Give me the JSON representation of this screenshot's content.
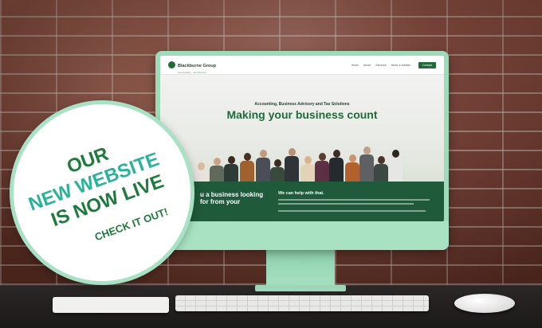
{
  "badge": {
    "line1": "OUR",
    "line2": "NEW WEBSITE",
    "line3": "IS NOW LIVE",
    "line4": "CHECK IT OUT!"
  },
  "website": {
    "logo_name": "Blackburne Group",
    "logo_tagline": "Accountants · Tax Advisors",
    "nav_items": [
      "Home",
      "About",
      "Services",
      "News & Articles"
    ],
    "nav_button": "Contact",
    "hero_kicker": "Accounting, Business Advisory and Tax Solutions",
    "hero_title": "Making your business count",
    "lower_left": "u a business looking for from your",
    "lower_heading": "We can help with that."
  },
  "colors": {
    "brand_green": "#1f6b3a",
    "accent_teal": "#2bb39a",
    "monitor_mint": "#9edbb8"
  }
}
